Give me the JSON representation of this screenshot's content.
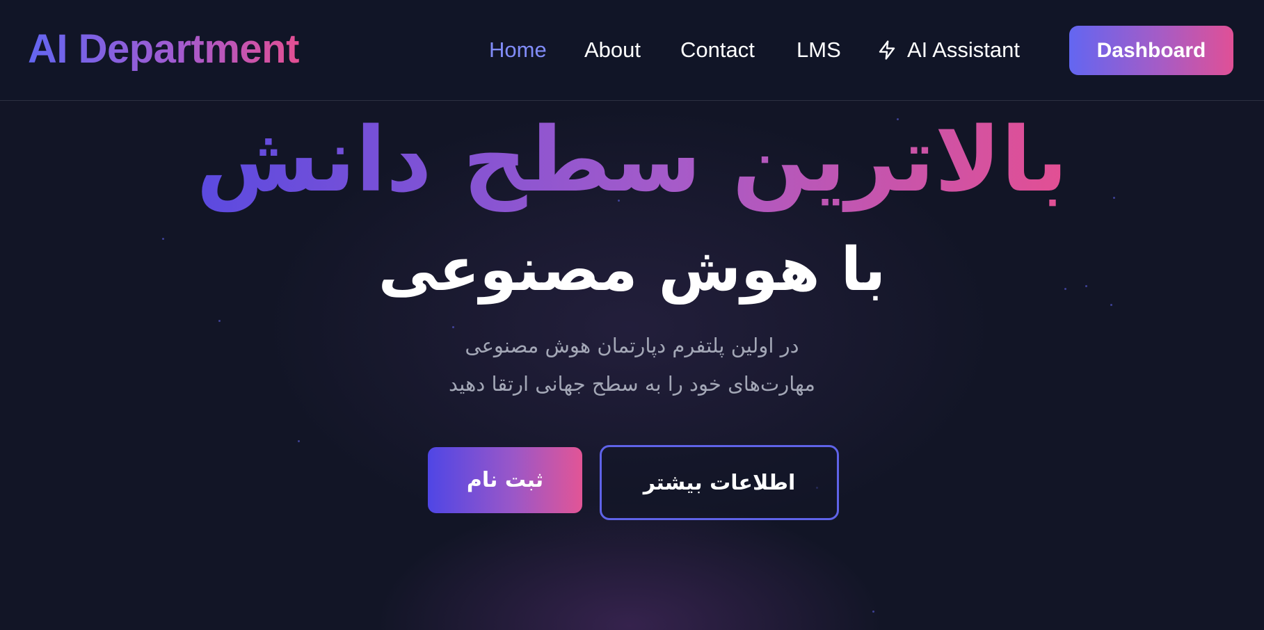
{
  "navbar": {
    "logo": "AI Department",
    "links": [
      {
        "label": "Home",
        "active": true
      },
      {
        "label": "About",
        "active": false
      },
      {
        "label": "Contact",
        "active": false
      },
      {
        "label": "LMS",
        "active": false
      }
    ],
    "assistant": {
      "label": "AI Assistant",
      "icon": "lightning-icon"
    },
    "dashboard_label": "Dashboard"
  },
  "hero": {
    "title": "بالاترین سطح دانش",
    "subtitle": "با هوش مصنوعی",
    "description": [
      "در اولین پلتفرم دپارتمان هوش مصنوعی",
      "مهارت‌های خود را به سطح جهانی ارتقا دهید"
    ],
    "register_label": "ثبت نام",
    "more_info_label": "اطلاعات بیشتر"
  },
  "colors": {
    "background": "#121526",
    "accent_indigo": "#6366f1",
    "accent_pink": "#e34f93",
    "active_link": "#818cf8",
    "muted_text": "#a3a7b6"
  }
}
